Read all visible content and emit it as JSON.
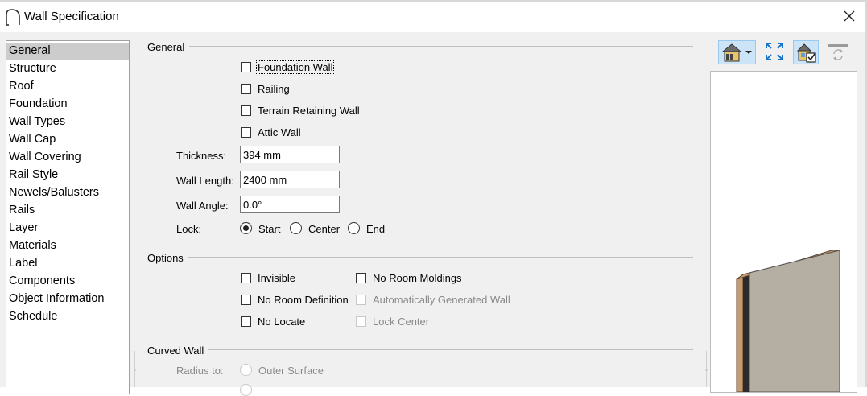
{
  "window": {
    "title": "Wall Specification",
    "icon": "wall-arc-icon",
    "close_icon": "close-icon"
  },
  "nav": {
    "selected": "General",
    "items": [
      "General",
      "Structure",
      "Roof",
      "Foundation",
      "Wall Types",
      "Wall Cap",
      "Wall Covering",
      "Rail Style",
      "Newels/Balusters",
      "Rails",
      "Layer",
      "Materials",
      "Label",
      "Components",
      "Object Information",
      "Schedule"
    ]
  },
  "general": {
    "heading": "General",
    "checkboxes": {
      "foundation_wall": {
        "label": "Foundation Wall",
        "checked": false
      },
      "railing": {
        "label": "Railing",
        "checked": false
      },
      "terrain_retaining_wall": {
        "label": "Terrain Retaining Wall",
        "checked": false
      },
      "attic_wall": {
        "label": "Attic Wall",
        "checked": false
      }
    },
    "thickness": {
      "label": "Thickness:",
      "value": "394 mm"
    },
    "wall_length": {
      "label": "Wall Length:",
      "value": "2400 mm"
    },
    "wall_angle": {
      "label": "Wall Angle:",
      "value": "0.0°"
    },
    "lock": {
      "label": "Lock:",
      "options": [
        "Start",
        "Center",
        "End"
      ],
      "selected": "Start"
    }
  },
  "options": {
    "heading": "Options",
    "invisible": {
      "label": "Invisible",
      "checked": false
    },
    "no_room_definition": {
      "label": "No Room Definition",
      "checked": false
    },
    "no_locate": {
      "label": "No Locate",
      "checked": false
    },
    "no_room_moldings": {
      "label": "No Room Moldings",
      "checked": false
    },
    "automatically_generated_wall": {
      "label": "Automatically Generated Wall",
      "checked": false,
      "enabled": false
    },
    "lock_center": {
      "label": "Lock Center",
      "checked": false,
      "enabled": false
    }
  },
  "curved_wall": {
    "heading": "Curved Wall",
    "radius_to": {
      "label": "Radius to:",
      "option": "Outer Surface",
      "enabled": false
    }
  },
  "toolbar": {
    "view_mode_icon": "house-view-dropdown-icon",
    "fill_window_icon": "fill-window-icon",
    "preview_toggle_icon": "preview-checked-icon",
    "refresh_icon": "refresh-preview-icon"
  },
  "colors": {
    "wall_face": "#b5afa3",
    "wall_edge": "#c79b6f",
    "wall_dark": "#2b2b2b",
    "selected_nav": "#cccccc",
    "active_tool": "#cce4f7"
  }
}
